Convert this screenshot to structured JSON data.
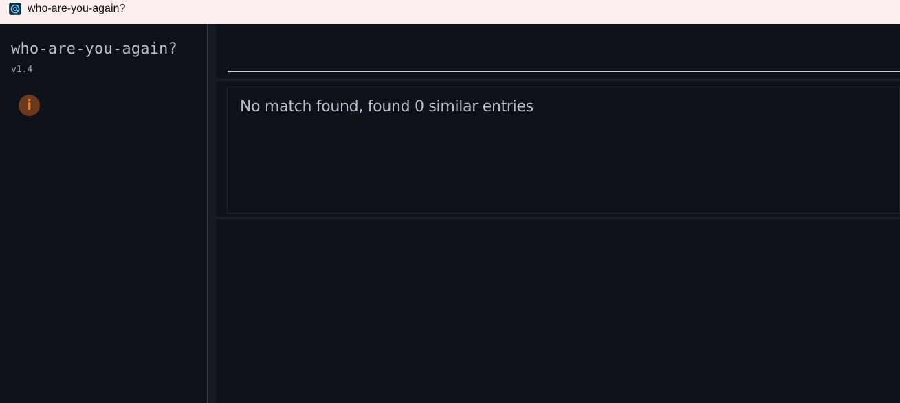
{
  "window": {
    "title": "who-are-you-again?",
    "icon": "at-sign-app-icon"
  },
  "sidebar": {
    "app_name": "who-are-you-again?",
    "version": "v1.4",
    "info_icon": "info-icon",
    "accent_color": "#e07a2e"
  },
  "search": {
    "value": "",
    "placeholder": ""
  },
  "results": {
    "message": "No match found, found 0 similar entries"
  },
  "colors": {
    "background": "#0e1118",
    "titlebar": "#fbf0ee",
    "text": "#b9bfcc",
    "info_button_bg": "#6b3a1e"
  }
}
